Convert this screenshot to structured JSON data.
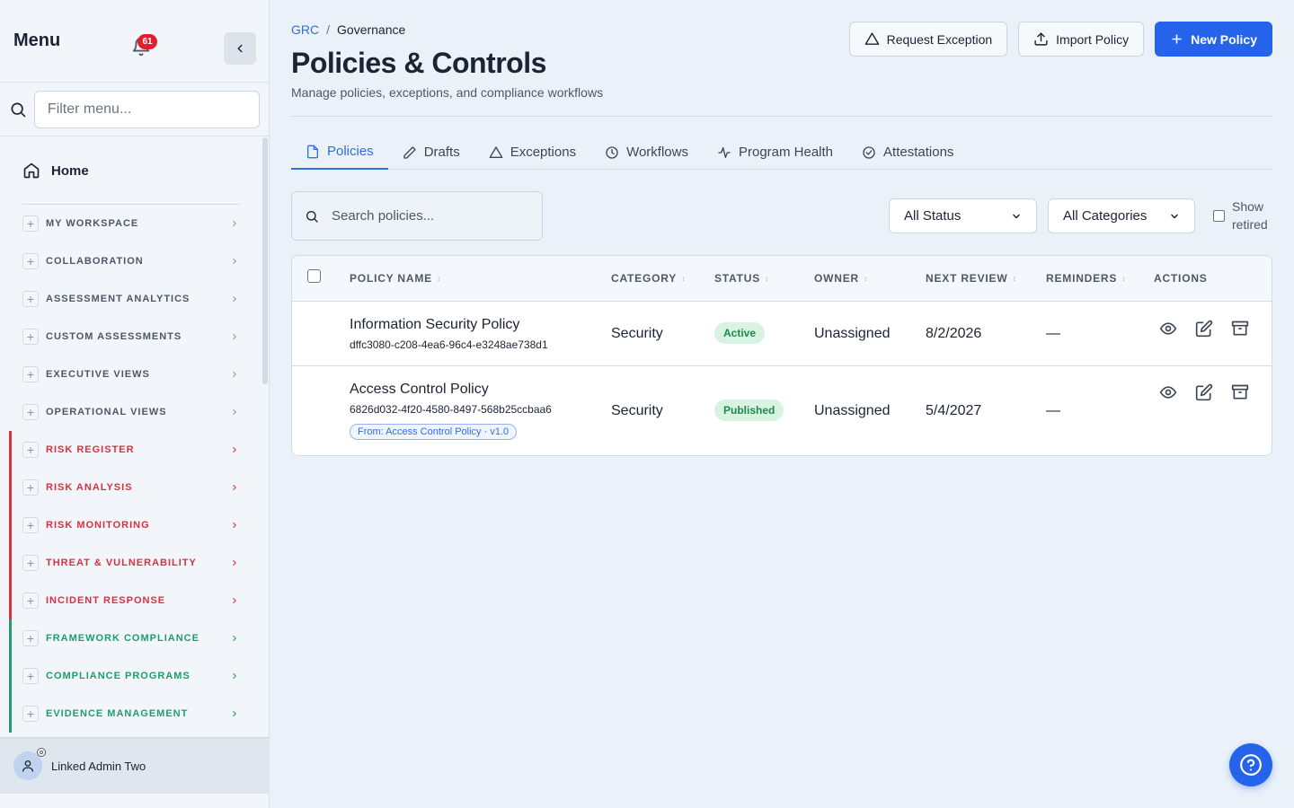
{
  "sidebar": {
    "title": "Menu",
    "notifications_count": "61",
    "filter_placeholder": "Filter menu...",
    "home_label": "Home",
    "sections": [
      {
        "label": "MY WORKSPACE",
        "color": "#4d5866",
        "bar": ""
      },
      {
        "label": "COLLABORATION",
        "color": "#4d5866",
        "bar": ""
      },
      {
        "label": "ASSESSMENT ANALYTICS",
        "color": "#4d5866",
        "bar": ""
      },
      {
        "label": "CUSTOM ASSESSMENTS",
        "color": "#4d5866",
        "bar": ""
      },
      {
        "label": "EXECUTIVE VIEWS",
        "color": "#4d5866",
        "bar": ""
      },
      {
        "label": "OPERATIONAL VIEWS",
        "color": "#4d5866",
        "bar": ""
      },
      {
        "label": "RISK REGISTER",
        "color": "#d93040",
        "bar": "#d93040"
      },
      {
        "label": "RISK ANALYSIS",
        "color": "#d93040",
        "bar": "#d93040"
      },
      {
        "label": "RISK MONITORING",
        "color": "#d93040",
        "bar": "#d93040"
      },
      {
        "label": "THREAT & VULNERABILITY",
        "color": "#d93040",
        "bar": "#d93040"
      },
      {
        "label": "INCIDENT RESPONSE",
        "color": "#d93040",
        "bar": "#d93040"
      },
      {
        "label": "FRAMEWORK COMPLIANCE",
        "color": "#1f9d6a",
        "bar": "#1f9d6a"
      },
      {
        "label": "COMPLIANCE PROGRAMS",
        "color": "#1f9d6a",
        "bar": "#1f9d6a"
      },
      {
        "label": "EVIDENCE MANAGEMENT",
        "color": "#1f9d6a",
        "bar": "#1f9d6a"
      }
    ],
    "user_name": "Linked Admin Two"
  },
  "header": {
    "breadcrumb_root": "GRC",
    "breadcrumb_sep": "/",
    "breadcrumb_current": "Governance",
    "title": "Policies & Controls",
    "subtitle": "Manage policies, exceptions, and compliance workflows",
    "request_exception_label": "Request Exception",
    "import_policy_label": "Import Policy",
    "new_policy_label": "New Policy"
  },
  "tabs": [
    {
      "label": "Policies",
      "icon": "document-icon",
      "active": true
    },
    {
      "label": "Drafts",
      "icon": "pencil-icon",
      "active": false
    },
    {
      "label": "Exceptions",
      "icon": "warning-icon",
      "active": false
    },
    {
      "label": "Workflows",
      "icon": "clock-icon",
      "active": false
    },
    {
      "label": "Program Health",
      "icon": "pulse-icon",
      "active": false
    },
    {
      "label": "Attestations",
      "icon": "check-circle-icon",
      "active": false
    }
  ],
  "filters": {
    "search_placeholder": "Search policies...",
    "status_value": "All Status",
    "category_value": "All Categories",
    "show_retired_line1": "Show",
    "show_retired_line2": "retired"
  },
  "table": {
    "columns": {
      "policy_name": "POLICY NAME",
      "category": "CATEGORY",
      "status": "STATUS",
      "owner": "OWNER",
      "next_review": "NEXT REVIEW",
      "reminders": "REMINDERS",
      "actions": "ACTIONS"
    },
    "rows": [
      {
        "name": "Information Security Policy",
        "id": "dffc3080-c208-4ea6-96c4-e3248ae738d1",
        "from": "",
        "category": "Security",
        "status": "Active",
        "owner": "Unassigned",
        "next_review": "8/2/2026",
        "reminders": "—"
      },
      {
        "name": "Access Control Policy",
        "id": "6826d032-4f20-4580-8497-568b25ccbaa6",
        "from": "From: Access Control Policy · v1.0",
        "category": "Security",
        "status": "Published",
        "owner": "Unassigned",
        "next_review": "5/4/2027",
        "reminders": "—"
      }
    ]
  },
  "colors": {
    "accent": "#2563eb",
    "risk": "#d93040",
    "compliance": "#1f9d6a",
    "status_green": "#1f8a4c"
  }
}
